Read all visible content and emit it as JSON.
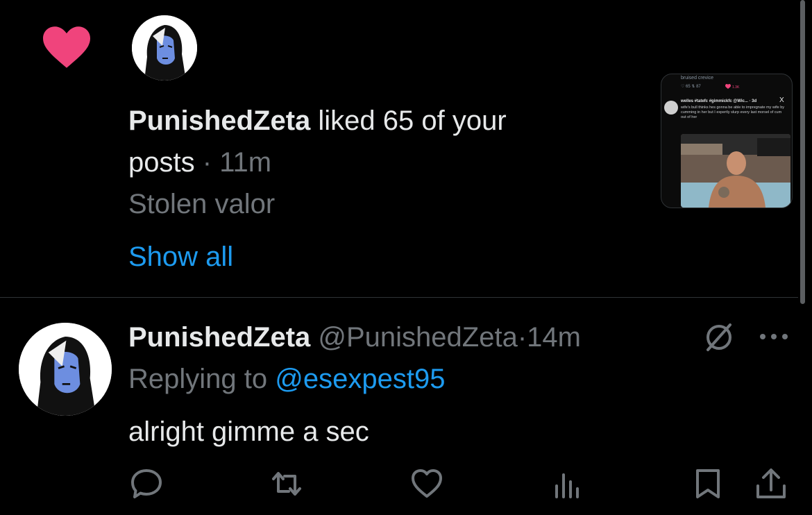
{
  "notification": {
    "actor": "PunishedZeta",
    "action": "liked 65 of your",
    "action_cont": "posts",
    "separator": "·",
    "time": "11m",
    "label": "Stolen valor",
    "show_all": "Show all",
    "heart_color": "#f0447c",
    "preview": {
      "header": "bruised crevice",
      "stats": "♡ 65   ⇅ 87",
      "likes": "1.3K",
      "author": "welles #tatefc #gimmickfc @Wic... · 3d",
      "close": "X",
      "body": "wife's bull thinks hes gonna be able to impregnate my wife by cumming in her but I expertly slurp every last morsel of cum out of her"
    }
  },
  "tweet": {
    "name": "PunishedZeta",
    "handle": "@PunishedZeta",
    "separator": "·",
    "time": "14m",
    "replying_prefix": "Replying to",
    "replying_handle": "@esexpest95",
    "text": "alright gimme a sec",
    "accent_color": "#1d9bf0"
  },
  "icons": [
    "heart-icon",
    "grok-icon",
    "more-icon",
    "reply-icon",
    "retweet-icon",
    "like-icon",
    "views-icon",
    "bookmark-icon",
    "share-icon"
  ]
}
